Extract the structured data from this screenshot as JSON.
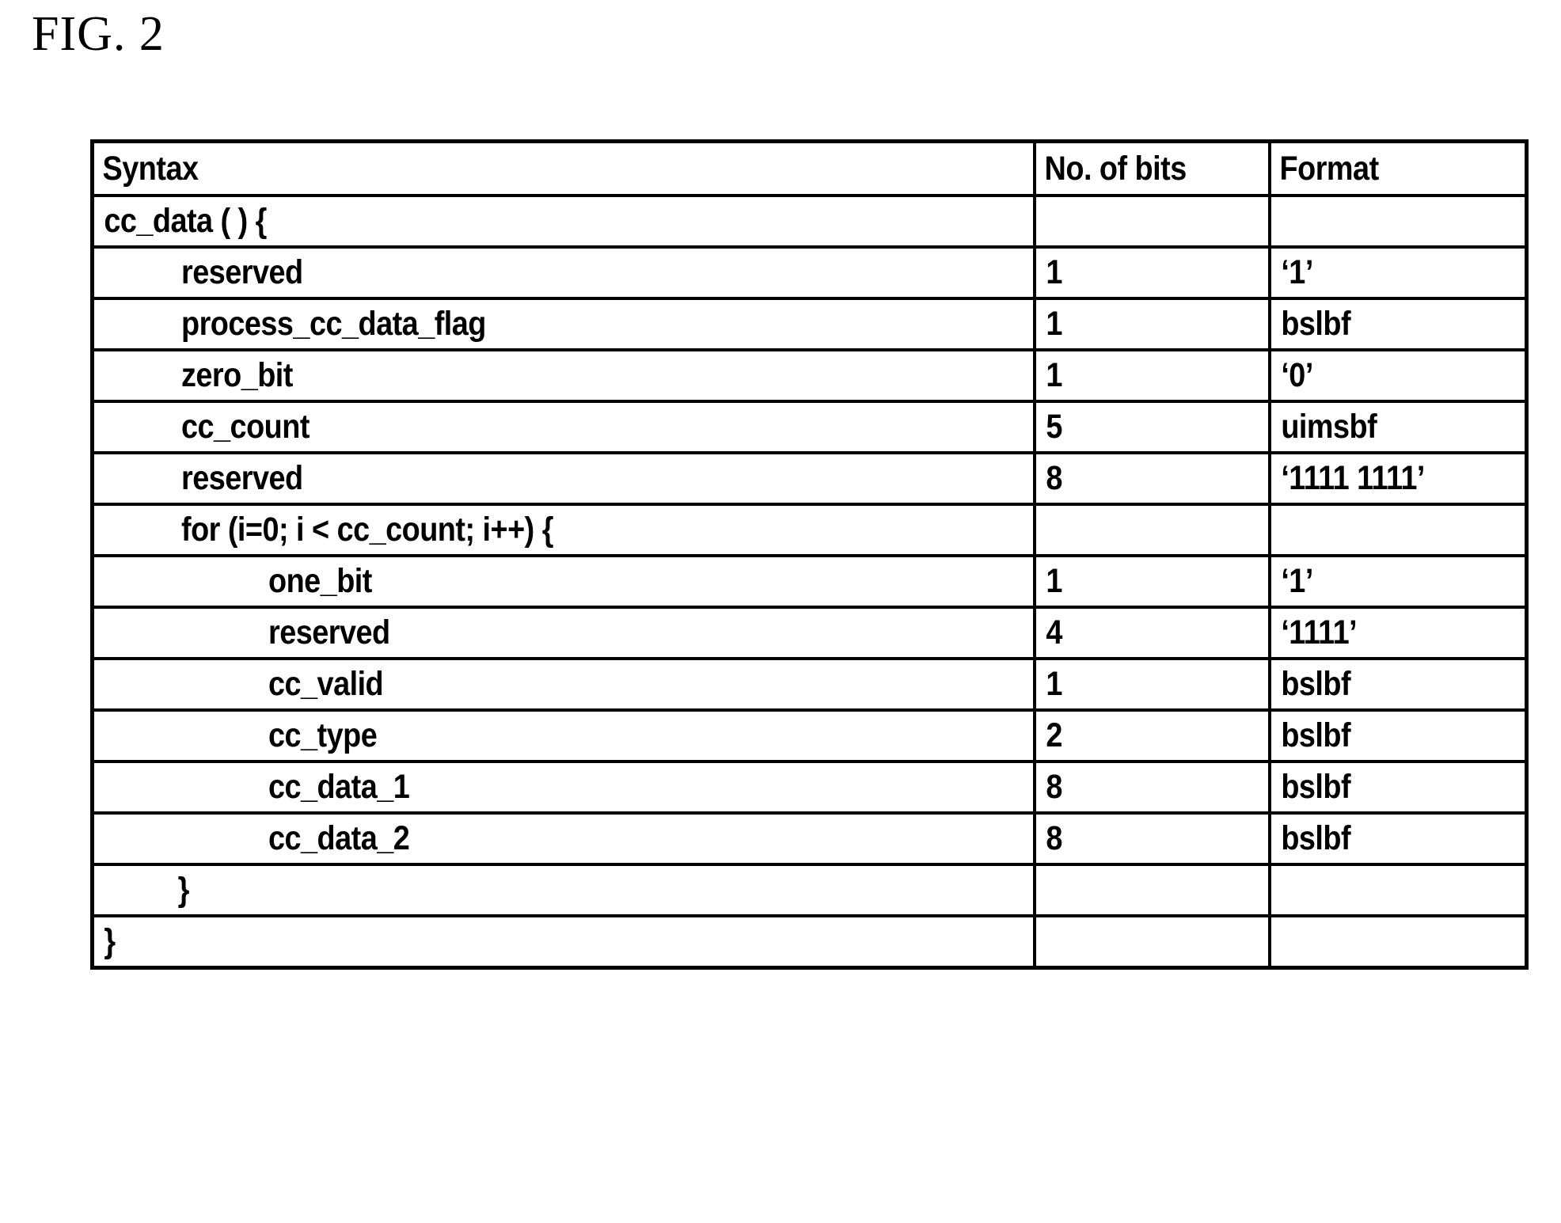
{
  "figure": {
    "title": "FIG. 2"
  },
  "table": {
    "columns": [
      "Syntax",
      "No. of bits",
      "Format"
    ],
    "rows": [
      {
        "syntax": "cc_data ( ) {",
        "indent": 0,
        "bits": "",
        "format": ""
      },
      {
        "syntax": "reserved",
        "indent": 1,
        "bits": "1",
        "format": "‘1’"
      },
      {
        "syntax": "process_cc_data_flag",
        "indent": 1,
        "bits": "1",
        "format": "bslbf"
      },
      {
        "syntax": "zero_bit",
        "indent": 1,
        "bits": "1",
        "format": "‘0’"
      },
      {
        "syntax": "cc_count",
        "indent": 1,
        "bits": "5",
        "format": "uimsbf"
      },
      {
        "syntax": "reserved",
        "indent": 1,
        "bits": "8",
        "format": "‘1111 1111’"
      },
      {
        "syntax": "for (i=0; i < cc_count; i++) {",
        "indent": 1,
        "bits": "",
        "format": ""
      },
      {
        "syntax": "one_bit",
        "indent": 2,
        "bits": "1",
        "format": "‘1’"
      },
      {
        "syntax": "reserved",
        "indent": 2,
        "bits": "4",
        "format": "‘1111’"
      },
      {
        "syntax": "cc_valid",
        "indent": 2,
        "bits": "1",
        "format": "bslbf"
      },
      {
        "syntax": "cc_type",
        "indent": 2,
        "bits": "2",
        "format": "bslbf"
      },
      {
        "syntax": "cc_data_1",
        "indent": 2,
        "bits": "8",
        "format": "bslbf"
      },
      {
        "syntax": "cc_data_2",
        "indent": 2,
        "bits": "8",
        "format": "bslbf"
      },
      {
        "syntax": "}",
        "indent": 3,
        "bits": "",
        "format": ""
      },
      {
        "syntax": "}",
        "indent": 0,
        "bits": "",
        "format": ""
      }
    ]
  }
}
